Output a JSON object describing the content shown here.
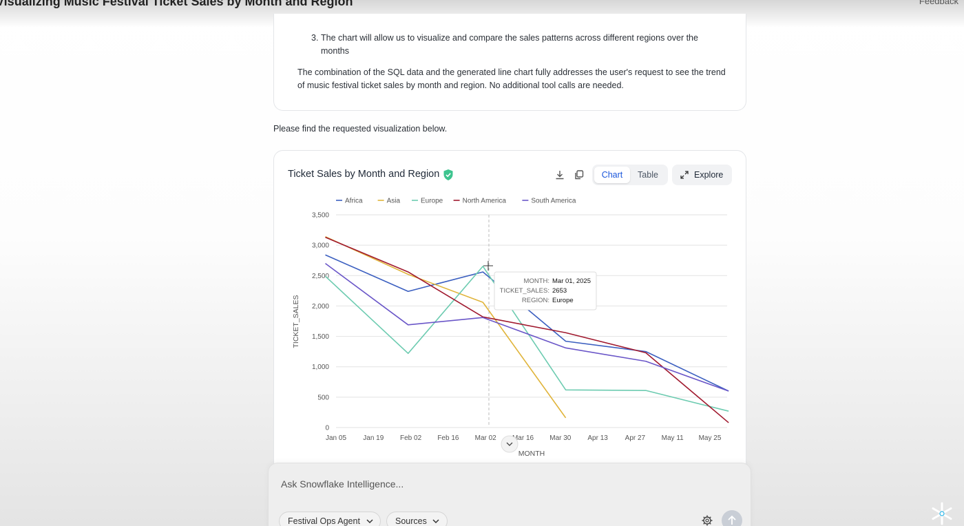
{
  "page": {
    "title": "Visualizing Music Festival Ticket Sales by Month and Region",
    "feedback_label": "Feedback"
  },
  "reasoning": {
    "item_number": "3.",
    "item_text": "The chart will allow us to visualize and compare the sales patterns across different regions over the months",
    "conclusion": "The combination of the SQL data and the generated line chart fully addresses the user's request to see the trend of music festival ticket sales by month and region. No additional tool calls are needed."
  },
  "intro_text": "Please find the requested visualization below.",
  "chart_card": {
    "title": "Ticket Sales by Month and Region",
    "download_icon": "download-icon",
    "copy_icon": "copy-icon",
    "verified_icon": "shield-check-icon",
    "view_tabs": [
      "Chart",
      "Table"
    ],
    "active_tab": "Chart",
    "explore_label": "Explore"
  },
  "chart_data": {
    "type": "line",
    "xlabel": "MONTH",
    "ylabel": "TICKET_SALES",
    "ylim": [
      0,
      3500
    ],
    "y_ticks": [
      "0",
      "500",
      "1,000",
      "1,500",
      "2,000",
      "2,500",
      "3,000",
      "3,500"
    ],
    "x_ticks": [
      "Jan 05",
      "Jan 19",
      "Feb 02",
      "Feb 16",
      "Mar 02",
      "Mar 16",
      "Mar 30",
      "Apr 13",
      "Apr 27",
      "May 11",
      "May 25"
    ],
    "x_dates": [
      "2025-01-01",
      "2025-02-01",
      "2025-03-01",
      "2025-04-01",
      "2025-05-01",
      "2025-06-01"
    ],
    "grid": true,
    "legend_position": "top-left",
    "series": [
      {
        "name": "Africa",
        "color": "#3b5fc0",
        "values": [
          2840,
          2240,
          2560,
          1420,
          1250,
          600
        ]
      },
      {
        "name": "Asia",
        "color": "#e0b43a",
        "values": [
          3140,
          2520,
          2060,
          160
        ]
      },
      {
        "name": "Europe",
        "color": "#6ccbb0",
        "values": [
          2490,
          1220,
          2653,
          620,
          610,
          270
        ]
      },
      {
        "name": "North America",
        "color": "#a0192e",
        "values": [
          3130,
          2560,
          1820,
          1560,
          1230,
          80
        ]
      },
      {
        "name": "South America",
        "color": "#6a56c8",
        "values": [
          2700,
          1690,
          1810,
          1310,
          1090,
          600
        ]
      }
    ],
    "tooltip": {
      "rows": [
        {
          "label": "MONTH:",
          "value": "Mar 01, 2025"
        },
        {
          "label": "TICKET_SALES:",
          "value": "2653"
        },
        {
          "label": "REGION:",
          "value": "Europe"
        }
      ]
    }
  },
  "composer": {
    "placeholder": "Ask Snowflake Intelligence...",
    "agent_label": "Festival Ops Agent",
    "sources_label": "Sources"
  },
  "logo_icon": "snowflake-logo-icon"
}
